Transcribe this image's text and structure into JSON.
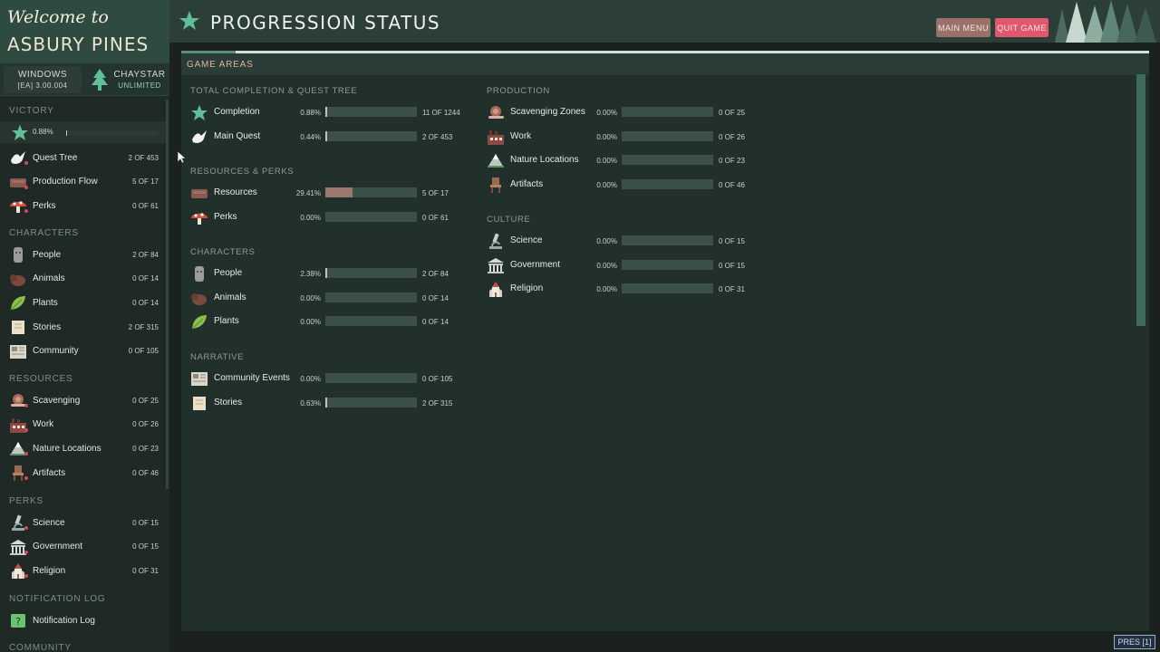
{
  "app": {
    "logo_line1": "Welcome to",
    "logo_line2": "ASBURY PINES",
    "platform": "WINDOWS",
    "version": "[EA] 3.00.004",
    "publisher": "CHAYSTAR",
    "edition": "UNLIMITED"
  },
  "header": {
    "title": "PROGRESSION STATUS",
    "main_menu": "MAIN MENU",
    "quit_game": "QUIT GAME"
  },
  "sidebar": {
    "victory_head": "VICTORY",
    "victory_pct": "0.88%",
    "victory_fill": 0.0088,
    "items_group1": [
      {
        "label": "Quest Tree",
        "count": "2 OF 453",
        "icon": "dove-icon"
      },
      {
        "label": "Production Flow",
        "count": "5 OF 17",
        "icon": "logs-icon"
      },
      {
        "label": "Perks",
        "count": "0 OF 61",
        "icon": "mushroom-icon"
      }
    ],
    "characters_head": "CHARACTERS",
    "characters": [
      {
        "label": "People",
        "count": "2 OF 84",
        "icon": "moai-head-icon"
      },
      {
        "label": "Animals",
        "count": "0 OF 14",
        "icon": "bison-icon"
      },
      {
        "label": "Plants",
        "count": "0 OF 14",
        "icon": "leaf-icon"
      },
      {
        "label": "Stories",
        "count": "2 OF 315",
        "icon": "scroll-icon"
      },
      {
        "label": "Community",
        "count": "0 OF 105",
        "icon": "newspaper-icon"
      }
    ],
    "resources_head": "RESOURCES",
    "resources": [
      {
        "label": "Scavenging",
        "count": "0 OF 25",
        "icon": "snail-icon"
      },
      {
        "label": "Work",
        "count": "0 OF 26",
        "icon": "factory-icon"
      },
      {
        "label": "Nature Locations",
        "count": "0 OF 23",
        "icon": "mountain-icon"
      },
      {
        "label": "Artifacts",
        "count": "0 OF 46",
        "icon": "chair-icon"
      }
    ],
    "perks_head": "PERKS",
    "perks": [
      {
        "label": "Science",
        "count": "0 OF 15",
        "icon": "microscope-icon"
      },
      {
        "label": "Government",
        "count": "0 OF 15",
        "icon": "capitol-icon"
      },
      {
        "label": "Religion",
        "count": "0 OF 31",
        "icon": "church-icon"
      }
    ],
    "notification_head": "NOTIFICATION LOG",
    "notification": {
      "label": "Notification Log",
      "icon": "help-box-icon"
    },
    "community_head": "COMMUNITY"
  },
  "panel": {
    "tab": "GAME AREAS",
    "left": {
      "sec1": "TOTAL COMPLETION & QUEST TREE",
      "rows1": [
        {
          "label": "Completion",
          "pct": "0.88%",
          "fill": 0.0088,
          "count": "11 OF 1244",
          "icon": "star-icon"
        },
        {
          "label": "Main Quest",
          "pct": "0.44%",
          "fill": 0.0044,
          "count": "2 OF 453",
          "icon": "dove-icon"
        }
      ],
      "sec2": "RESOURCES & PERKS",
      "rows2": [
        {
          "label": "Resources",
          "pct": "29.41%",
          "fill": 0.2941,
          "count": "5 OF 17",
          "icon": "logs-icon"
        },
        {
          "label": "Perks",
          "pct": "0.00%",
          "fill": 0,
          "count": "0 OF 61",
          "icon": "mushroom-icon"
        }
      ],
      "sec3": "CHARACTERS",
      "rows3": [
        {
          "label": "People",
          "pct": "2.38%",
          "fill": 0.0238,
          "count": "2 OF 84",
          "icon": "moai-head-icon"
        },
        {
          "label": "Animals",
          "pct": "0.00%",
          "fill": 0,
          "count": "0 OF 14",
          "icon": "bison-icon"
        },
        {
          "label": "Plants",
          "pct": "0.00%",
          "fill": 0,
          "count": "0 OF 14",
          "icon": "leaf-icon"
        }
      ],
      "sec4": "NARRATIVE",
      "rows4": [
        {
          "label": "Community Events",
          "pct": "0.00%",
          "fill": 0,
          "count": "0 OF 105",
          "icon": "newspaper-icon"
        },
        {
          "label": "Stories",
          "pct": "0.63%",
          "fill": 0.0063,
          "count": "2 OF 315",
          "icon": "scroll-icon"
        }
      ]
    },
    "right": {
      "sec1": "PRODUCTION",
      "rows1": [
        {
          "label": "Scavenging Zones",
          "pct": "0.00%",
          "fill": 0,
          "count": "0 OF 25",
          "icon": "snail-icon"
        },
        {
          "label": "Work",
          "pct": "0.00%",
          "fill": 0,
          "count": "0 OF 26",
          "icon": "factory-icon"
        },
        {
          "label": "Nature Locations",
          "pct": "0.00%",
          "fill": 0,
          "count": "0 OF 23",
          "icon": "mountain-icon"
        },
        {
          "label": "Artifacts",
          "pct": "0.00%",
          "fill": 0,
          "count": "0 OF 46",
          "icon": "chair-icon"
        }
      ],
      "sec2": "CULTURE",
      "rows2": [
        {
          "label": "Science",
          "pct": "0.00%",
          "fill": 0,
          "count": "0 OF 15",
          "icon": "microscope-icon"
        },
        {
          "label": "Government",
          "pct": "0.00%",
          "fill": 0,
          "count": "0 OF 15",
          "icon": "capitol-icon"
        },
        {
          "label": "Religion",
          "pct": "0.00%",
          "fill": 0,
          "count": "0 OF 31",
          "icon": "church-icon"
        }
      ]
    }
  },
  "pres_tag": "PRES [1]",
  "colors": {
    "accent_green": "#5fbf99",
    "bar_track": "#3a5049",
    "bar_fill": "#c9c2b8",
    "resources_fill": "#9a7870",
    "quit_button": "#e0586e",
    "menu_button": "#9b7068",
    "section_head_sidebar": "#7d8f88",
    "tab_label": "#e6b09a"
  }
}
